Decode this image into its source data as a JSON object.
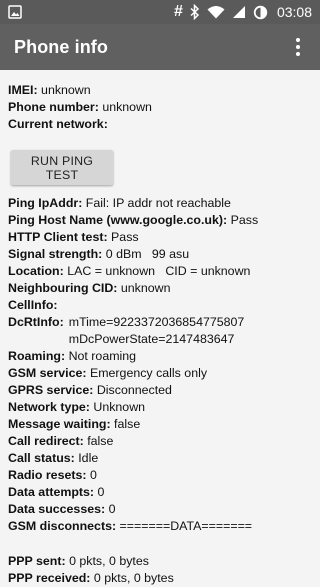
{
  "status_bar": {
    "left_icon": "image-icon",
    "right_icons": [
      "hash-icon",
      "bluetooth-icon",
      "wifi-icon",
      "signal-icon",
      "sync-icon"
    ],
    "hash": "#",
    "time": "03:08"
  },
  "app_bar": {
    "title": "Phone info",
    "overflow_icon": "more-vert-icon"
  },
  "top_rows": [
    {
      "label": "IMEI:",
      "value": " unknown"
    },
    {
      "label": "Phone number:",
      "value": " unknown"
    },
    {
      "label": "Current network:",
      "value": ""
    }
  ],
  "ping_button_label": "RUN PING TEST",
  "rows": [
    {
      "label": "Ping IpAddr:",
      "value": " Fail: IP addr not reachable"
    },
    {
      "label": "Ping Host Name (www.google.co.uk):",
      "value": " Pass"
    },
    {
      "label": "HTTP Client test:",
      "value": " Pass"
    },
    {
      "label": "Signal strength:",
      "value": " 0 dBm   99 asu"
    },
    {
      "label": "Location:",
      "value": " LAC = unknown   CID = unknown"
    },
    {
      "label": "Neighbouring CID:",
      "value": " unknown"
    },
    {
      "label": "CellInfo:",
      "value": ""
    }
  ],
  "dcrt": {
    "label": "DcRtInfo:",
    "line1": "mTime=9223372036854775807",
    "line2": "mDcPowerState=2147483647"
  },
  "rows2": [
    {
      "label": "Roaming:",
      "value": " Not roaming"
    },
    {
      "label": "GSM service:",
      "value": " Emergency calls only"
    },
    {
      "label": "GPRS service:",
      "value": " Disconnected"
    },
    {
      "label": "Network type:",
      "value": " Unknown"
    },
    {
      "label": "Message waiting:",
      "value": " false"
    },
    {
      "label": "Call redirect:",
      "value": " false"
    },
    {
      "label": "Call status:",
      "value": " Idle"
    },
    {
      "label": "Radio resets:",
      "value": " 0"
    },
    {
      "label": "Data attempts:",
      "value": " 0"
    },
    {
      "label": "Data successes:",
      "value": " 0"
    },
    {
      "label": "GSM disconnects:",
      "value": " =======DATA======="
    }
  ],
  "rows3": [
    {
      "label": "PPP sent:",
      "value": " 0 pkts, 0 bytes"
    },
    {
      "label": "PPP received:",
      "value": " 0 pkts, 0 bytes"
    }
  ]
}
